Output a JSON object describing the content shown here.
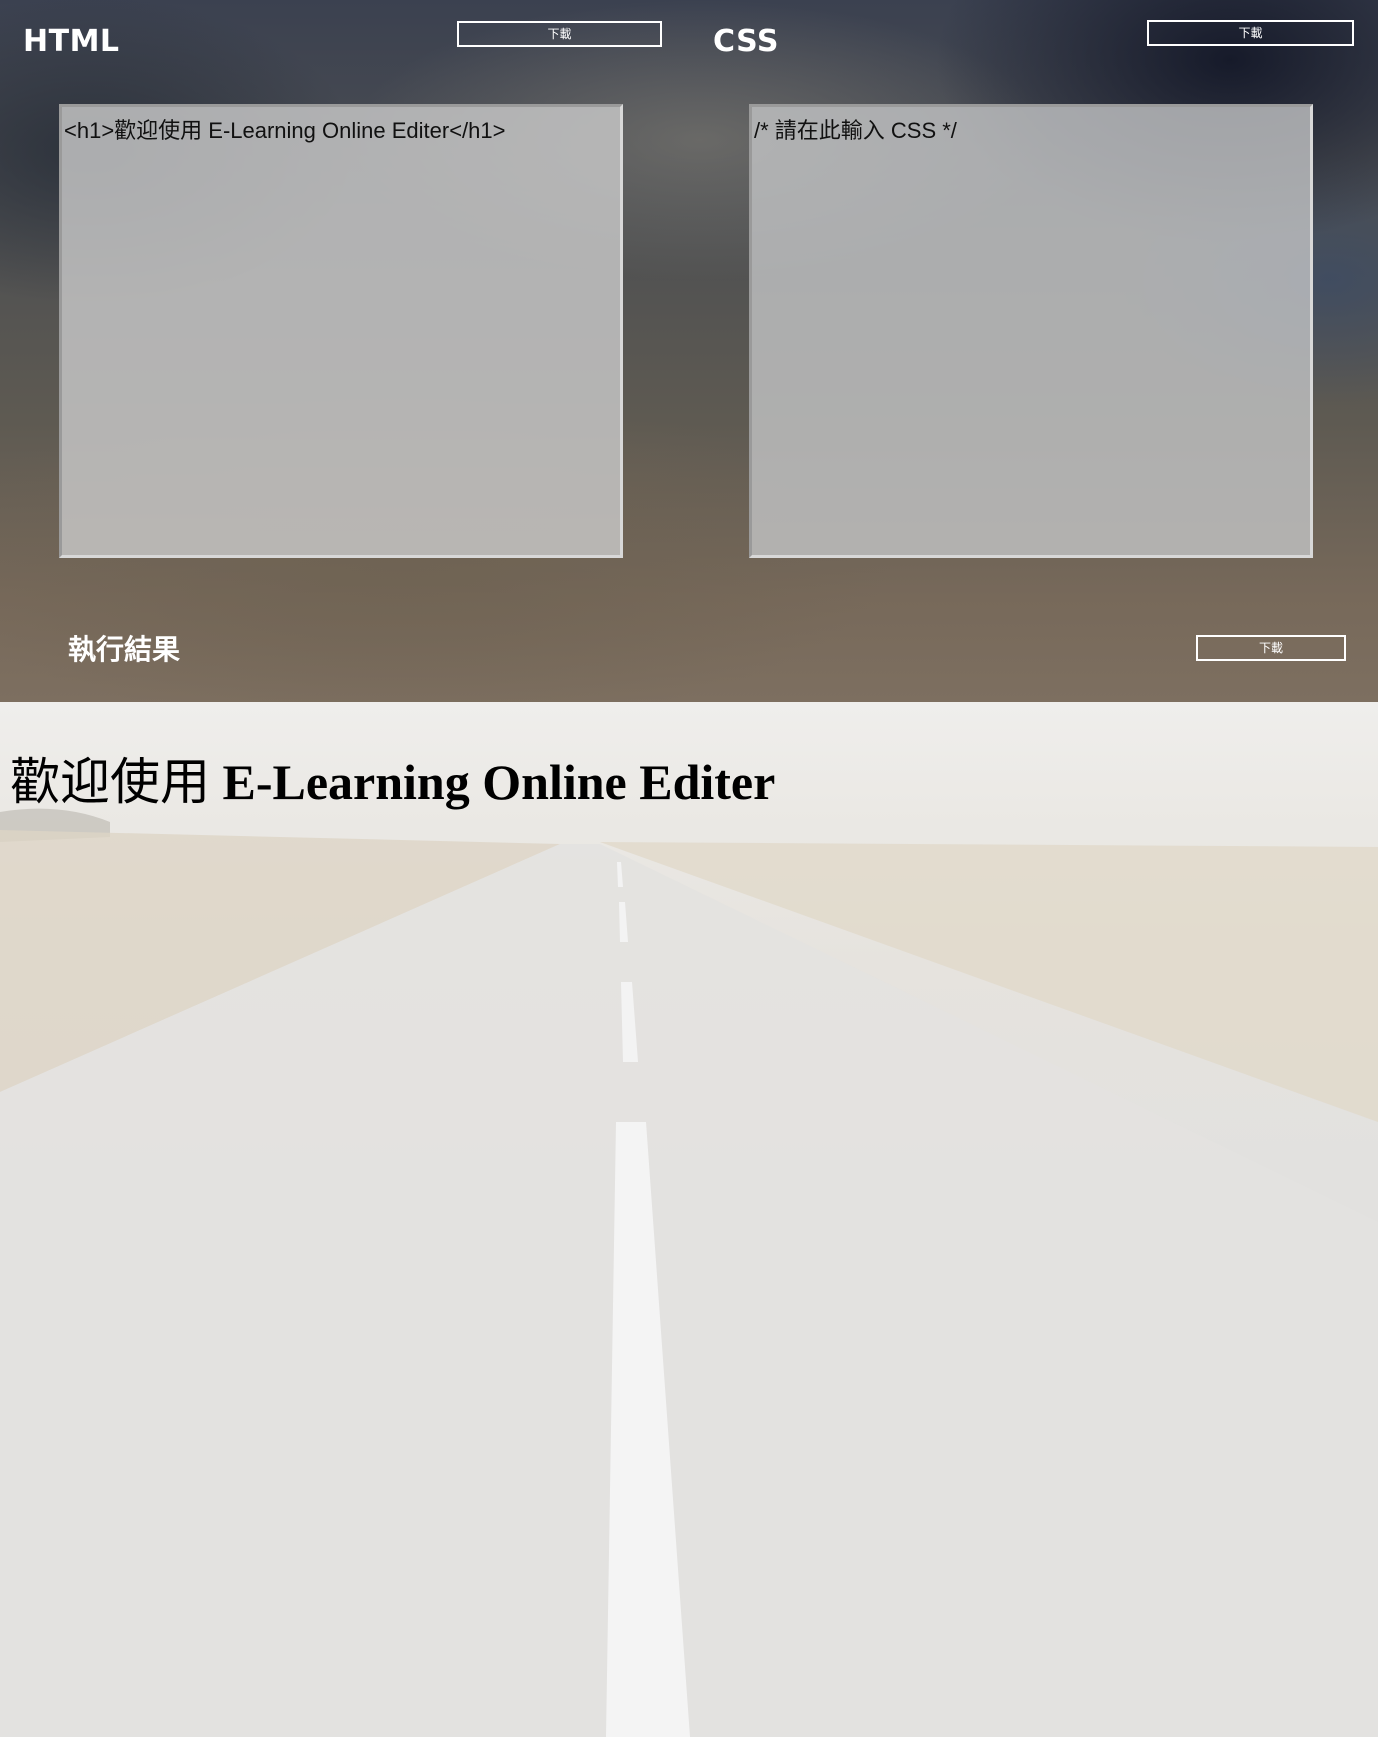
{
  "html_panel": {
    "title": "HTML",
    "download_label": "下載",
    "code": "<h1>歡迎使用 E-Learning Online Editer</h1>"
  },
  "css_panel": {
    "title": "CSS",
    "download_label": "下載",
    "code": "/* 請在此輸入 CSS */"
  },
  "result_panel": {
    "title": "執行結果",
    "download_label": "下載",
    "heading_cjk": "歡迎使用",
    "heading_latin": "E-Learning Online Editer"
  }
}
